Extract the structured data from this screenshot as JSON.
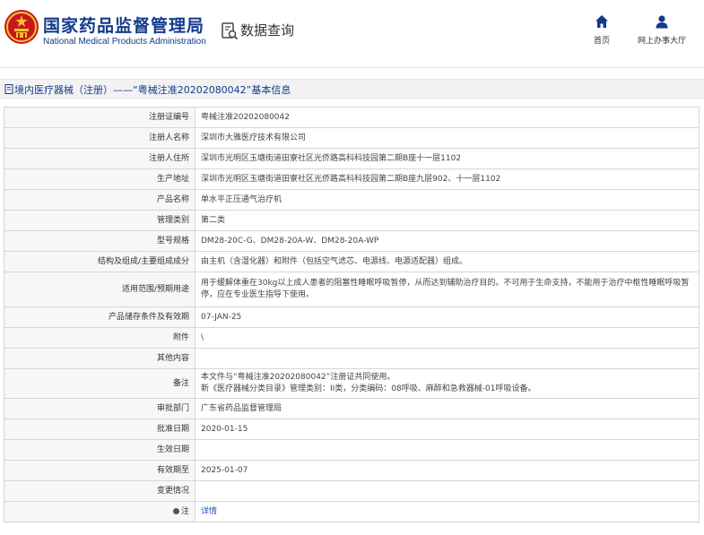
{
  "header": {
    "brand_cn": "国家药品监督管理局",
    "brand_en": "National Medical Products Administration",
    "query_title": "数据查询",
    "nav": [
      {
        "label": "首页",
        "icon": "home-icon"
      },
      {
        "label": "网上办事大厅",
        "icon": "user-icon"
      }
    ]
  },
  "breadcrumb": {
    "text": "境内医疗器械（注册）——“粤械注准20202080042”基本信息"
  },
  "colors": {
    "brand": "#123a8c",
    "link": "#1f4fb5",
    "border": "#d6d6d6",
    "label_bg": "#f7f7f7"
  },
  "rows": [
    {
      "label": "注册证编号",
      "value": "粤械注准20202080042"
    },
    {
      "label": "注册人名称",
      "value": "深圳市大雅医疗技术有限公司"
    },
    {
      "label": "注册人住所",
      "value": "深圳市光明区玉塘街道田寮社区光侨路高科科技园第二期B座十一层1102"
    },
    {
      "label": "生产地址",
      "value": "深圳市光明区玉塘街道田寮社区光侨路高科科技园第二期B座九层902、十一层1102"
    },
    {
      "label": "产品名称",
      "value": "单水平正压通气治疗机"
    },
    {
      "label": "管理类别",
      "value": "第二类"
    },
    {
      "label": "型号规格",
      "value": "DM28-20C-G、DM28-20A-W、DM28-20A-WP"
    },
    {
      "label": "结构及组成/主要组成成分",
      "value": "由主机（含湿化器）和附件（包括空气滤芯、电源线、电源适配器）组成。"
    },
    {
      "label": "适用范围/预期用途",
      "value": "用于缓解体重在30kg以上成人患者的阻塞性睡眠呼吸暂停，从而达到辅助治疗目的。不可用于生命支持，不能用于治疗中枢性睡眠呼吸暂停，应在专业医生指导下使用。"
    },
    {
      "label": "产品储存条件及有效期",
      "value": "07-JAN-25"
    },
    {
      "label": "附件",
      "value": "\\"
    },
    {
      "label": "其他内容",
      "value": ""
    },
    {
      "label": "备注",
      "value": "本文件与“粤械注准20202080042”注册证共同使用。",
      "value2": "新《医疗器械分类目录》管理类别：II类，分类编码：08呼吸、麻醉和急救器械-01呼吸设备。"
    },
    {
      "label": "审批部门",
      "value": "广东省药品监督管理局"
    },
    {
      "label": "批准日期",
      "value": "2020-01-15"
    },
    {
      "label": "生效日期",
      "value": ""
    },
    {
      "label": "有效期至",
      "value": "2025-01-07"
    },
    {
      "label": "变更情况",
      "value": ""
    },
    {
      "label": "注",
      "value": "详情"
    }
  ]
}
